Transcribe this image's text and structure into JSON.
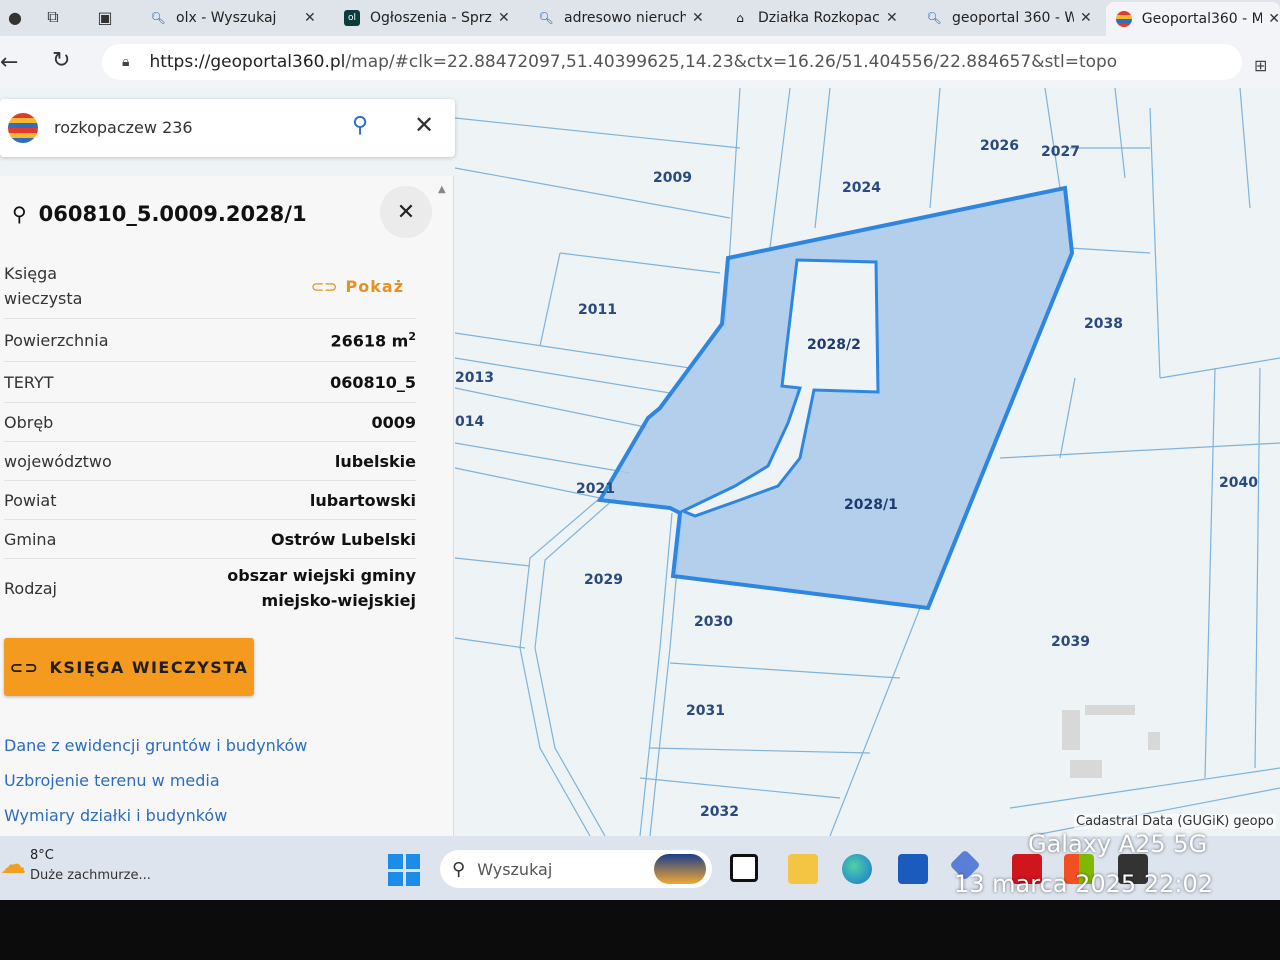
{
  "browser": {
    "tabs": [
      {
        "title": "olx - Wyszukaj",
        "icon": "search-icon"
      },
      {
        "title": "Ogłoszenia - Sprz",
        "icon": "olx-icon"
      },
      {
        "title": "adresowo nieruch",
        "icon": "search-icon"
      },
      {
        "title": "Działka Rozkopac",
        "icon": "house-icon"
      },
      {
        "title": "geoportal 360 - W",
        "icon": "search-icon"
      },
      {
        "title": "Geoportal360 - M",
        "icon": "geoportal-icon",
        "active": true
      }
    ],
    "url_host": "https://geoportal360.pl",
    "url_path": "/map/#clk=22.88472097,51.40399625,14.23&ctx=16.26/51.404556/22.884657&stl=topo"
  },
  "search": {
    "query": "rozkopaczew 236"
  },
  "parcel": {
    "id": "060810_5.0009.2028/1",
    "rows": {
      "ksiega_label": "Księga\nwieczysta",
      "ksiega_link": "Pokaż",
      "powierzchnia_label": "Powierzchnia",
      "powierzchnia_value": "26618 m",
      "powierzchnia_unit_sup": "2",
      "teryt_label": "TERYT",
      "teryt_value": "060810_5",
      "obreb_label": "Obręb",
      "obreb_value": "0009",
      "wojewodztwo_label": "województwo",
      "wojewodztwo_value": "lubelskie",
      "powiat_label": "Powiat",
      "powiat_value": "lubartowski",
      "gmina_label": "Gmina",
      "gmina_value": "Ostrów Lubelski",
      "rodzaj_label": "Rodzaj",
      "rodzaj_value": "obszar wiejski gminy miejsko-wiejskiej"
    },
    "kw_button": "KSIĘGA WIECZYSTA",
    "links": [
      "Dane z ewidencji gruntów i budynków",
      "Uzbrojenie terenu w media",
      "Wymiary działki i budynków"
    ]
  },
  "map": {
    "labels": [
      "2009",
      "2024",
      "2026",
      "2027",
      "2011",
      "2038",
      "2028/2",
      "2013",
      "014",
      "2021",
      "2028/1",
      "2040",
      "2029",
      "2030",
      "2039",
      "2031",
      "2032"
    ],
    "attribution": "Cadastral Data (GUGiK) geopo",
    "highlight_color": "#2f86e0"
  },
  "taskbar": {
    "temp": "8°C",
    "weather": "Duże zachmurze...",
    "search_placeholder": "Wyszukaj"
  },
  "overlay": {
    "model": "Galaxy A25 5G",
    "datetime": "13 marca 2025 22:02"
  }
}
